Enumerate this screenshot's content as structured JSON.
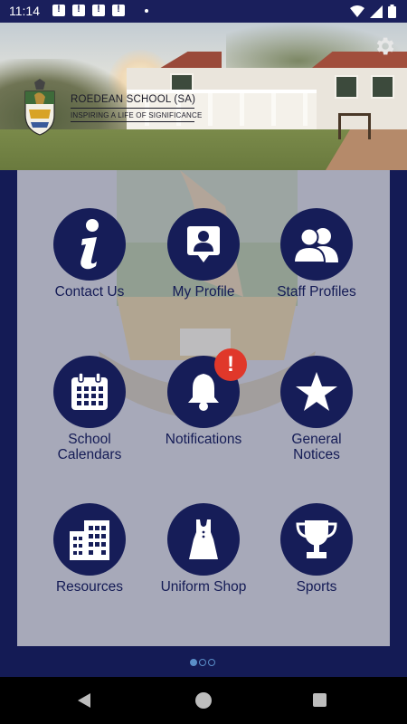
{
  "status_bar": {
    "time": "11:14",
    "notification_icons": [
      "alert-notification-icon",
      "alert-notification-icon",
      "alert-notification-icon",
      "alert-notification-icon"
    ],
    "right_icons": [
      "wifi-icon",
      "signal-icon",
      "battery-icon"
    ]
  },
  "header": {
    "school_name": "ROEDEAN SCHOOL (SA)",
    "motto": "INSPIRING A LIFE OF SIGNIFICANCE",
    "settings_icon": "gear-icon"
  },
  "tiles": [
    {
      "id": "contact-us",
      "label": "Contact Us",
      "icon": "info-icon"
    },
    {
      "id": "my-profile",
      "label": "My Profile",
      "icon": "profile-card-icon"
    },
    {
      "id": "staff-profiles",
      "label": "Staff Profiles",
      "icon": "users-icon"
    },
    {
      "id": "school-calendars",
      "label": "School\nCalendars",
      "icon": "calendar-icon"
    },
    {
      "id": "notifications",
      "label": "Notifications",
      "icon": "bell-icon",
      "badge": "!"
    },
    {
      "id": "general-notices",
      "label": "General\nNotices",
      "icon": "star-icon"
    },
    {
      "id": "resources",
      "label": "Resources",
      "icon": "building-icon"
    },
    {
      "id": "uniform-shop",
      "label": "Uniform Shop",
      "icon": "dress-icon"
    },
    {
      "id": "sports",
      "label": "Sports",
      "icon": "trophy-icon"
    }
  ],
  "pager": {
    "pages": 3,
    "active": 1
  },
  "colors": {
    "navy": "#141b55",
    "panel": "#a7a9b9",
    "badge": "#e0382a",
    "pager": "#5a8ec8"
  }
}
